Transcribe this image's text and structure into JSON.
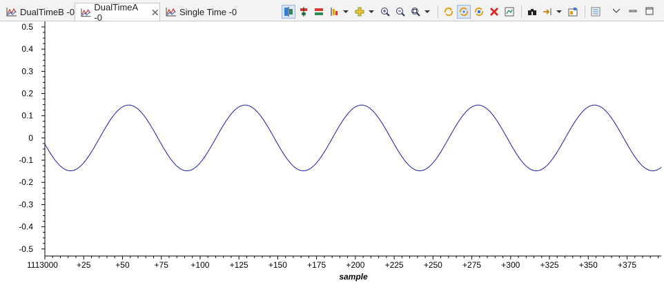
{
  "tabs": [
    {
      "label": "DualTimeB -0",
      "active": false
    },
    {
      "label": "DualTimeA -0",
      "active": true
    },
    {
      "label": "Single Time -0",
      "active": false
    }
  ],
  "toolbar": {
    "icons": [
      "align-markers-icon",
      "center-markers-icon",
      "fit-markers-icon",
      "insert-marker-icon",
      "add-icon",
      "zoom-in-icon",
      "zoom-out-icon",
      "zoom-fit-icon",
      "refresh-icon",
      "auto-refresh-icon",
      "refresh-all-icon",
      "delete-icon",
      "graph-properties-icon",
      "binoculars-icon",
      "export-icon",
      "snapshot-icon",
      "view-menu-icon"
    ]
  },
  "view_controls": [
    "view-menu-icon",
    "minimize-icon",
    "maximize-icon"
  ],
  "colors": {
    "series": "#1a1aa6",
    "axis": "#000000",
    "tab_bg": "#f3f3f3",
    "pressed": "#dbe6f5"
  },
  "chart_data": {
    "type": "line",
    "xlabel": "sample",
    "ylabel": "",
    "x_origin_label": "1113000",
    "x_tick_labels": [
      "+25",
      "+50",
      "+75",
      "+100",
      "+125",
      "+150",
      "+175",
      "+200",
      "+225",
      "+250",
      "+275",
      "+300",
      "+325",
      "+350",
      "+375"
    ],
    "x_ticks": [
      25,
      50,
      75,
      100,
      125,
      150,
      175,
      200,
      225,
      250,
      275,
      300,
      325,
      350,
      375
    ],
    "y_tick_labels": [
      "0.5",
      "0.4",
      "0.3",
      "0.2",
      "0.1",
      "0",
      "-0.1",
      "-0.2",
      "-0.3",
      "-0.4",
      "-0.5"
    ],
    "y_ticks": [
      0.5,
      0.4,
      0.3,
      0.2,
      0.1,
      0,
      -0.1,
      -0.2,
      -0.3,
      -0.4,
      -0.5
    ],
    "xlim": [
      0,
      397
    ],
    "ylim": [
      -0.51,
      0.5
    ],
    "grid": false,
    "series": [
      {
        "color": "#1a1aa6",
        "amplitude": 0.148,
        "period_samples": 75,
        "peak_at_sample": 54,
        "x_start": 0,
        "x_end": 397
      }
    ]
  }
}
